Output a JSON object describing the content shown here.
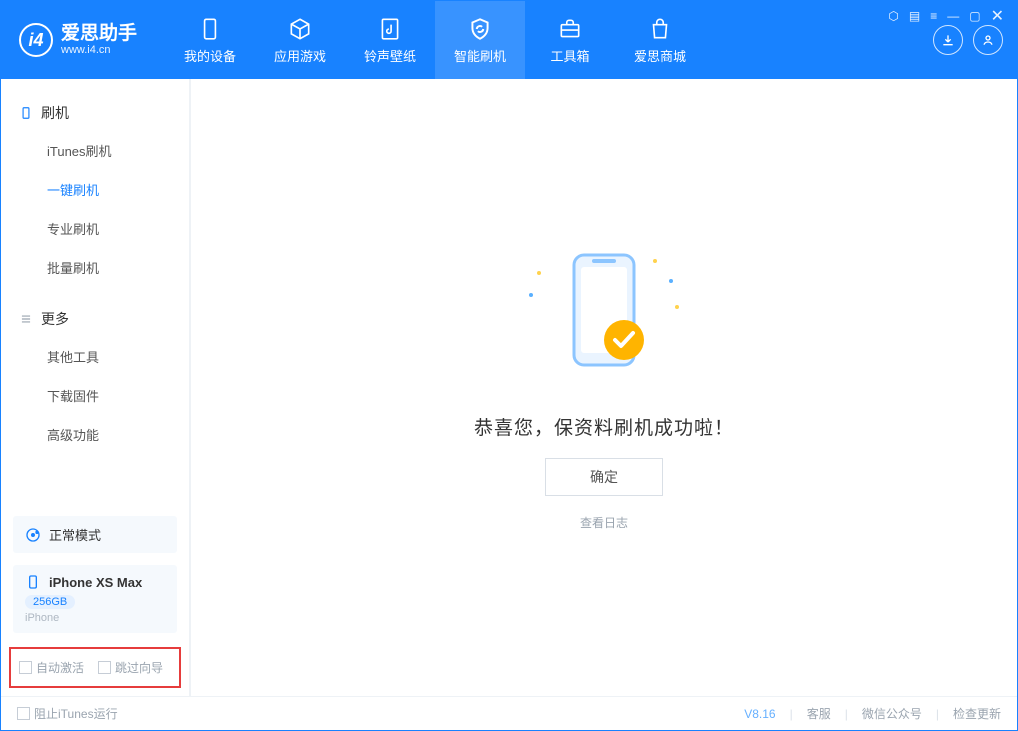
{
  "app": {
    "name": "爱思助手",
    "site": "www.i4.cn"
  },
  "tabs": {
    "device": "我的设备",
    "apps": "应用游戏",
    "media": "铃声壁纸",
    "flash": "智能刷机",
    "toolbox": "工具箱",
    "store": "爱思商城"
  },
  "sidebar": {
    "flash_header": "刷机",
    "items": {
      "itunes": "iTunes刷机",
      "oneclick": "一键刷机",
      "pro": "专业刷机",
      "batch": "批量刷机"
    },
    "more_header": "更多",
    "more": {
      "other": "其他工具",
      "firmware": "下载固件",
      "advanced": "高级功能"
    }
  },
  "device": {
    "mode_label": "正常模式",
    "name": "iPhone XS Max",
    "capacity": "256GB",
    "type": "iPhone"
  },
  "options": {
    "auto_activate": "自动激活",
    "skip_guide": "跳过向导"
  },
  "main": {
    "success_msg": "恭喜您，保资料刷机成功啦！",
    "ok": "确定",
    "view_log": "查看日志"
  },
  "footer": {
    "block_itunes": "阻止iTunes运行",
    "version": "V8.16",
    "support": "客服",
    "wechat": "微信公众号",
    "update": "检查更新"
  }
}
